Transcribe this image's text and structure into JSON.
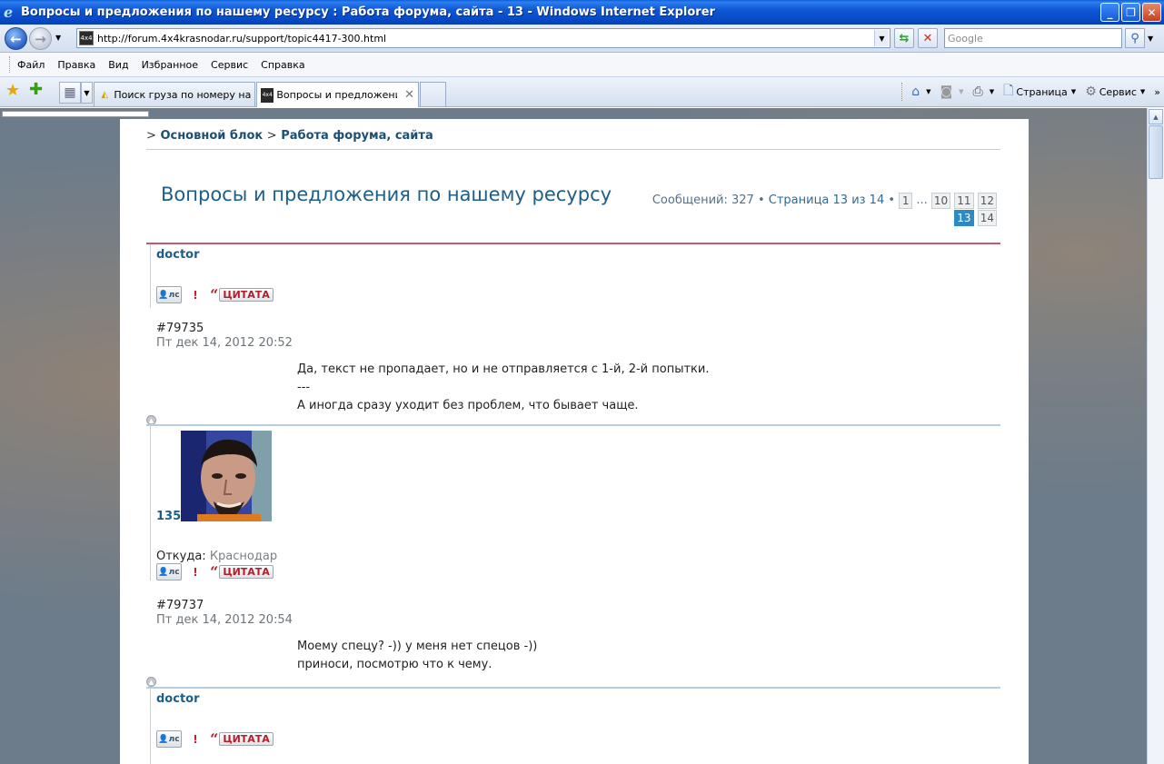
{
  "window": {
    "title": "Вопросы и предложения по нашему ресурсу : Работа форума, сайта - 13 - Windows Internet Explorer"
  },
  "address": {
    "url": "http://forum.4x4krasnodar.ru/support/topic4417-300.html",
    "search_placeholder": "Google"
  },
  "menu": [
    "Файл",
    "Правка",
    "Вид",
    "Избранное",
    "Сервис",
    "Справка"
  ],
  "tabs": [
    {
      "label": "Поиск груза по номеру нак...",
      "active": false
    },
    {
      "label": "Вопросы и предложени...",
      "active": true
    }
  ],
  "commands": {
    "page": "Страница",
    "tools": "Сервис",
    "more": "»"
  },
  "breadcrumb": {
    "prefix": ">",
    "items": [
      "Основной блок",
      "Работа форума, сайта"
    ]
  },
  "topic": {
    "title": "Вопросы и предложения по нашему ресурсу",
    "messages_label": "Сообщений: 327",
    "bullet": "•",
    "page_label": "Страница 13 из 14",
    "ellipsis": "...",
    "pages": [
      "1",
      "10",
      "11",
      "12",
      "13",
      "14"
    ],
    "current_page": "13"
  },
  "buttons": {
    "pm": "лс",
    "report": "!",
    "quote": "ЦИТАТА"
  },
  "posts": [
    {
      "author": "doctor",
      "id": "#79735",
      "date": "Пт дек 14, 2012 20:52",
      "body": "Да, текст не пропадает, но и не отправляется с 1-й, 2-й попытки.\n---\nА иногда сразу уходит без проблем, что бывает чаще."
    },
    {
      "author": "135",
      "location_label": "Откуда:",
      "location": "Краснодар",
      "id": "#79737",
      "date": "Пт дек 14, 2012 20:54",
      "body": "Моему спецу? -)) у меня нет спецов -))\nприноси, посмотрю что к чему."
    },
    {
      "author": "doctor"
    }
  ],
  "colors": {
    "link": "#1e5e86",
    "topic_rule": "#c45b6e",
    "post_divider": "#b7cde0",
    "active_page": "#2d8bc0"
  }
}
